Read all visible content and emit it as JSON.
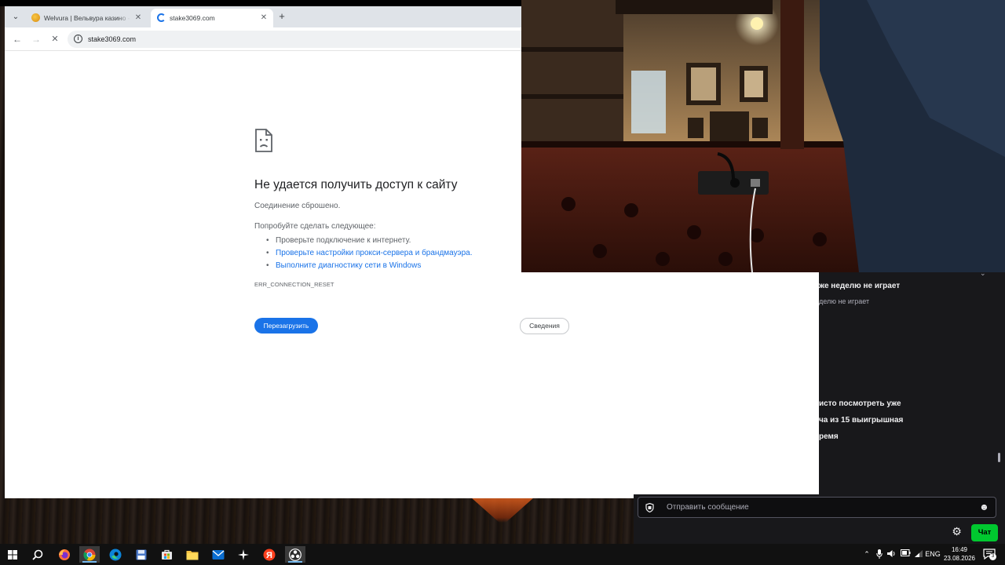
{
  "browser": {
    "tabs": [
      {
        "title": "Welvura | Вельвура казино - оф"
      },
      {
        "title": "stake3069.com"
      }
    ],
    "new_tab_label": "+",
    "url": "stake3069.com"
  },
  "error": {
    "title": "Не удается получить доступ к сайту",
    "subtitle": "Соединение сброшено.",
    "try_label": "Попробуйте сделать следующее:",
    "suggestions": [
      "Проверьте подключение к интернету.",
      "Проверьте настройки прокси-сервера и брандмауэра.",
      "Выполните диагностику сети в Windows"
    ],
    "code": "ERR_CONNECTION_RESET",
    "reload_label": "Перезагрузить",
    "details_label": "Сведения"
  },
  "chat": {
    "messages": [
      "же неделю не играет",
      "делю не играет",
      "исто посмотреть уже",
      "ча из 15 выигрышная",
      "ремя"
    ],
    "input_placeholder": "Отправить сообщение",
    "send_label": "Чат"
  },
  "taskbar": {
    "tray_lang": "ENG",
    "time": "16:49",
    "date": "23.08.2026",
    "notification_count": "3"
  },
  "colors": {
    "accent_blue": "#1a73e8",
    "chat_bg": "#18181b",
    "send_green": "#00c82f",
    "taskbar_bg": "#111111"
  }
}
